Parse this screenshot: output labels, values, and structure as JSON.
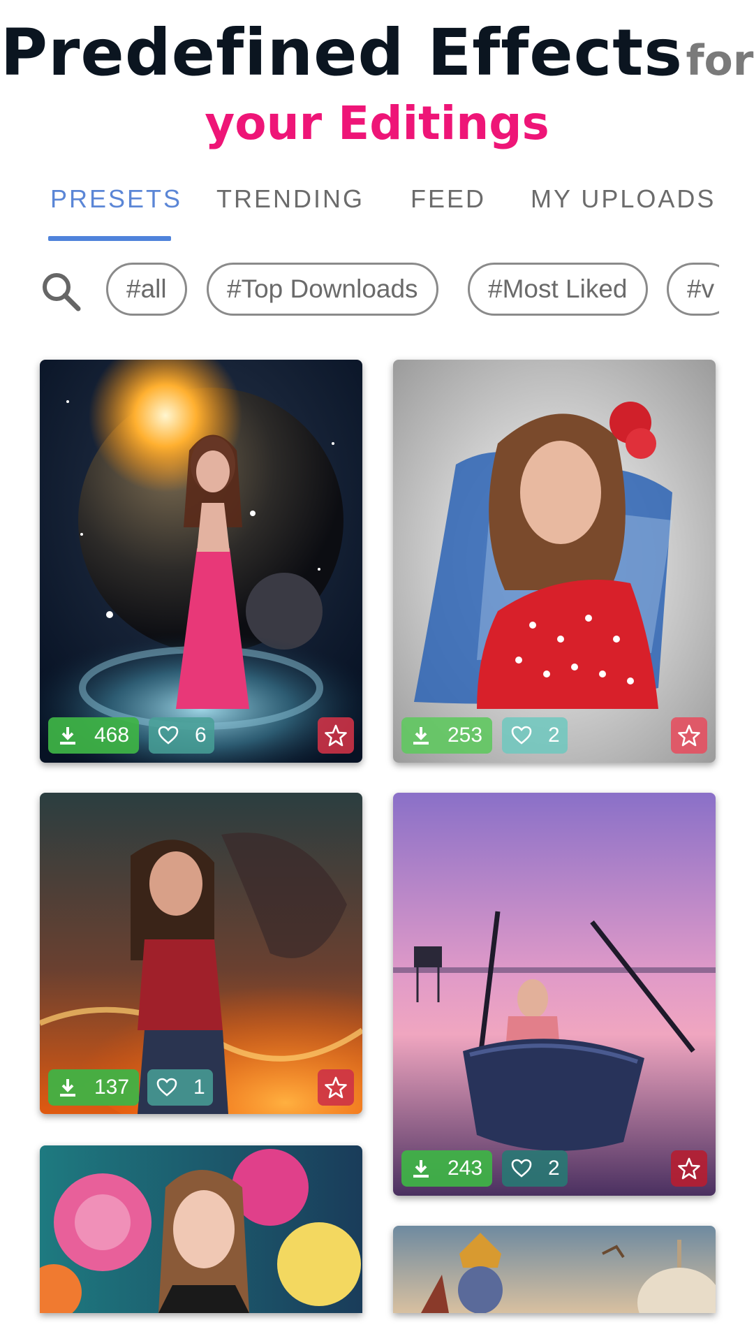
{
  "headline": {
    "line1_main": "Predefined Effects",
    "line1_suffix": "for",
    "line2": "your Editings"
  },
  "tabs": [
    {
      "label": "PRESETS",
      "active": true
    },
    {
      "label": "TRENDING",
      "active": false
    },
    {
      "label": "FEED",
      "active": false
    },
    {
      "label": "MY UPLOADS",
      "active": false
    }
  ],
  "tags": [
    "#all",
    "#Top Downloads",
    "#Most Liked",
    "#v"
  ],
  "cards": [
    {
      "downloads": "468",
      "likes": "6"
    },
    {
      "downloads": "253",
      "likes": "2"
    },
    {
      "downloads": "137",
      "likes": "1"
    },
    {
      "downloads": "243",
      "likes": "2"
    },
    {},
    {}
  ],
  "icons": {
    "search": "search-icon",
    "download": "download-icon",
    "heart": "heart-icon",
    "star": "star-icon"
  },
  "colors": {
    "accent": "#4f83db",
    "headline_pink": "#ee1577",
    "download_badge": "#3eb446",
    "like_badge": "#48a096",
    "favorite_badge": "#cd3246"
  }
}
